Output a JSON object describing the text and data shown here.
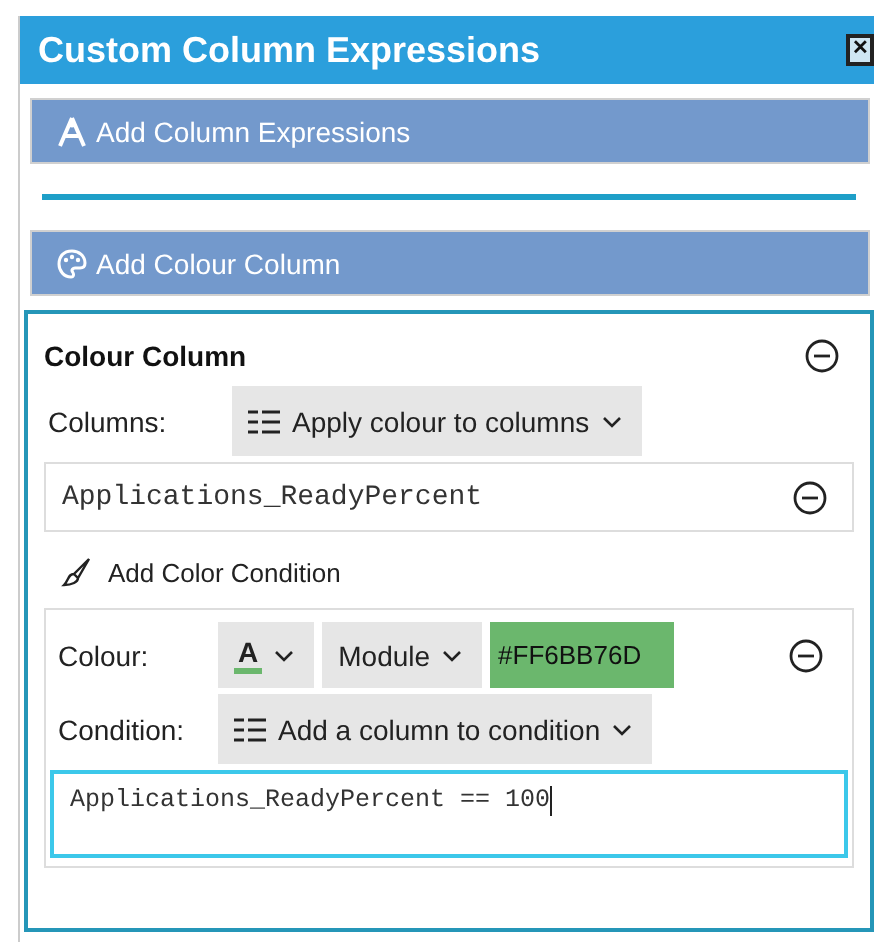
{
  "window": {
    "title": "Custom Column Expressions",
    "close": "✕"
  },
  "add_expressions_button": {
    "label": "Add Column Expressions"
  },
  "add_colour_column_button": {
    "label": "Add Colour Column"
  },
  "colour_column": {
    "title": "Colour Column",
    "columns_label": "Columns:",
    "columns_dropdown": {
      "label": "Apply colour to columns"
    },
    "columns": [
      {
        "name": "Applications_ReadyPercent"
      }
    ],
    "add_condition_link": "Add Color Condition",
    "conditions": [
      {
        "colour_label": "Colour:",
        "font_glyph": "A",
        "mode": "Module",
        "colour_value": "#FF6BB76D",
        "condition_label": "Condition:",
        "condition_dropdown": "Add a column to condition",
        "expression": "Applications_ReadyPercent == 100",
        "focused": true
      }
    ]
  }
}
